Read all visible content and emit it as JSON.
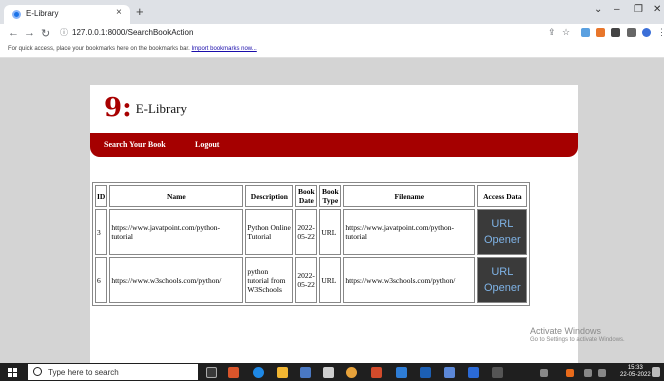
{
  "browser": {
    "tab_title": "E-Library",
    "tab_close": "×",
    "new_tab": "+",
    "address": "127.0.0.1:8000/SearchBookAction",
    "bookmark_prompt": "For quick access, place your bookmarks here on the bookmarks bar.",
    "bookmark_link": "Import bookmarks now..."
  },
  "site": {
    "logo_mark": "9:",
    "logo_text": "E-Library",
    "nav": [
      "Search Your Book",
      "Logout"
    ]
  },
  "table": {
    "headers": [
      "ID",
      "Name",
      "Description",
      "Book Date",
      "Book Type",
      "Filename",
      "Access Data"
    ],
    "rows": [
      {
        "id": "3",
        "name": "https://www.javatpoint.com/python-tutorial",
        "description": "Python Online Tutorial",
        "date": "2022-05-22",
        "type": "URL",
        "filename": "https://www.javatpoint.com/python-tutorial",
        "access": "URL Opener"
      },
      {
        "id": "6",
        "name": "https://www.w3schools.com/python/",
        "description": "python tutorial from W3Schools",
        "date": "2022-05-22",
        "type": "URL",
        "filename": "https://www.w3schools.com/python/",
        "access": "URL Opener"
      }
    ]
  },
  "watermark": {
    "line1": "Activate Windows",
    "line2": "Go to Settings to activate Windows."
  },
  "taskbar": {
    "search_placeholder": "Type here to search",
    "time": "15:33",
    "date": "22-05-2022"
  }
}
